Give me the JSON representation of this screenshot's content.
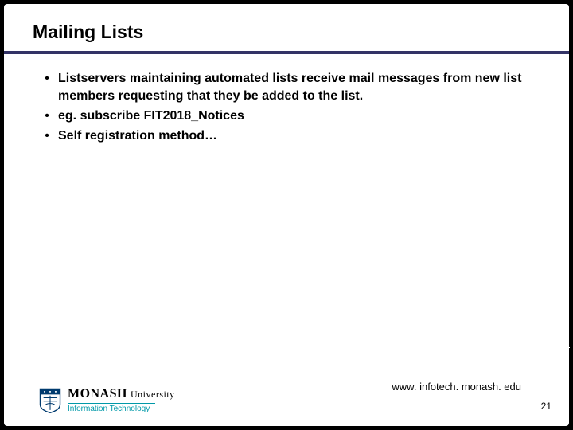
{
  "title": "Mailing Lists",
  "bullets": [
    "Listservers maintaining automated lists receive mail messages from new list members requesting that they be added to the list.",
    "eg. subscribe FIT2018_Notices",
    "Self registration method…"
  ],
  "brand": {
    "name_main": "MONASH",
    "name_sub": "University",
    "department": "Information Technology"
  },
  "footer": {
    "url": "www. infotech. monash. edu",
    "page_number": "21"
  }
}
